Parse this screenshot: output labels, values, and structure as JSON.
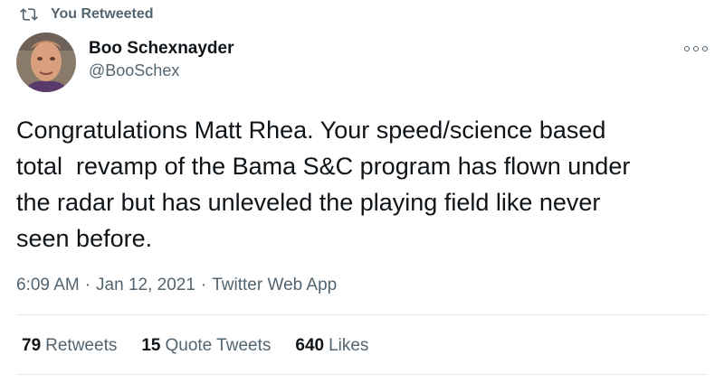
{
  "retweet_context": {
    "icon": "retweet-icon",
    "text": "You Retweeted"
  },
  "author": {
    "display_name": "Boo Schexnayder",
    "handle": "@BooSchex",
    "avatar_icon": "user-avatar"
  },
  "menu": {
    "icon": "more-options-icon"
  },
  "tweet": {
    "text": "Congratulations Matt Rhea. Your speed/science based\ntotal  revamp of the Bama S&C program has flown under\nthe radar but has unleveled the playing field like never\nseen before."
  },
  "meta": {
    "time": "6:09 AM",
    "separator": "·",
    "date": "Jan 12, 2021",
    "source": "Twitter Web App"
  },
  "stats": {
    "retweets": {
      "count": "79",
      "label": "Retweets"
    },
    "quote_tweets": {
      "count": "15",
      "label": "Quote Tweets"
    },
    "likes": {
      "count": "640",
      "label": "Likes"
    }
  },
  "colors": {
    "text": "#0f1419",
    "secondary": "#536471",
    "divider": "#e6e9eb"
  }
}
